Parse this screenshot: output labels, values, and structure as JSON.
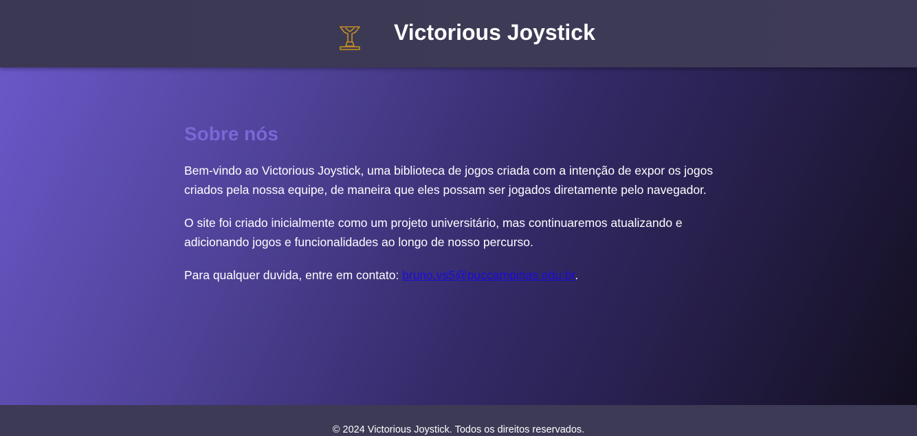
{
  "header": {
    "logo_icon": "joystick-trophy-icon",
    "logo_color": "#c7901f",
    "title": "Victorious Joystick"
  },
  "main": {
    "section_title": "Sobre nós",
    "paragraph_1": "Bem-vindo ao Victorious Joystick, uma biblioteca de jogos criada com a intenção de expor os jogos criados pela nossa equipe, de maneira que eles possam ser jogados diretamente pelo navegador.",
    "paragraph_2": "O site foi criado inicialmente como um projeto universitário, mas continuaremos atualizando e adicionando jogos e funcionalidades ao longo de nosso percurso.",
    "contact_prefix": "Para qualquer duvida, entre em contato: ",
    "contact_email": "bruno.vs5@puccampinas.edu.br",
    "contact_suffix": "."
  },
  "footer": {
    "copyright": "© 2024 Victorious Joystick. Todos os direitos reservados."
  },
  "colors": {
    "header_bg": "#3c3a55",
    "section_title": "#7a68d6",
    "link": "#1a0dd8",
    "gradient_start": "#6a58c8",
    "gradient_end": "#130f20"
  }
}
